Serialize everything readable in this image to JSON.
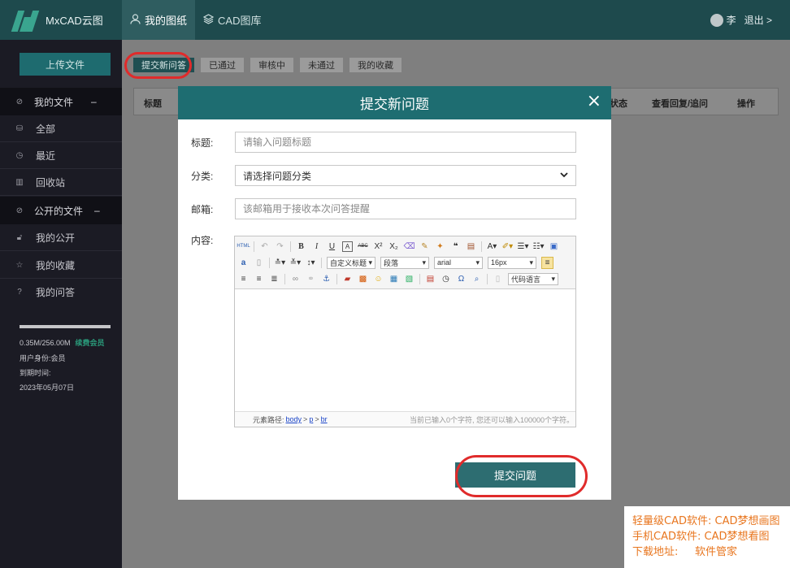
{
  "app": {
    "logo_text": "MxCAD云图"
  },
  "topnav": [
    {
      "label": "我的图纸",
      "icon": "user-icon",
      "active": true
    },
    {
      "label": "CAD图库",
      "icon": "layers-icon",
      "active": false
    }
  ],
  "user": {
    "name": "李",
    "logout": "退出 >"
  },
  "sidebar": {
    "upload": "上传文件",
    "my_files": {
      "label": "我的文件",
      "toggle": "–"
    },
    "my_file_items": [
      {
        "label": "全部",
        "icon": "database-icon"
      },
      {
        "label": "最近",
        "icon": "clock-icon"
      },
      {
        "label": "回收站",
        "icon": "trash-icon"
      }
    ],
    "public_files": {
      "label": "公开的文件",
      "toggle": "–"
    },
    "public_items": [
      {
        "label": "我的公开",
        "icon": "unlock-icon"
      },
      {
        "label": "我的收藏",
        "icon": "star-icon"
      },
      {
        "label": "我的问答",
        "icon": "question-icon"
      }
    ],
    "usage": "0.35M/256.00M",
    "renew": "续费会员",
    "identity": "用户身份:会员",
    "expire_label": "到期时间:",
    "expire_date": "2023年05月07日"
  },
  "tabs": [
    "提交新问答",
    "已通过",
    "审核中",
    "未通过",
    "我的收藏"
  ],
  "table_headers": {
    "title": "标题",
    "status": "状态",
    "reply": "查看回复/追问",
    "action": "操作"
  },
  "modal": {
    "title": "提交新问题",
    "close": "×",
    "title_label": "标题:",
    "title_placeholder": "请输入问题标题",
    "category_label": "分类:",
    "category_value": "请选择问题分类",
    "email_label": "邮箱:",
    "email_placeholder": "该邮箱用于接收本次问答提醒",
    "content_label": "内容:",
    "editor": {
      "combos": [
        "自定义标题",
        "段落",
        "arial",
        "16px"
      ],
      "code_lang": "代码语言",
      "path_label": "元素路径:",
      "path_body": "body",
      "path_p": "p",
      "path_br": "br",
      "char_count": "当前已输入0个字符, 您还可以输入100000个字符。"
    },
    "submit": "提交问题"
  },
  "ad": {
    "line1": "轻量级CAD软件: CAD梦想画图",
    "line2": "手机CAD软件:  CAD梦想看图",
    "line3": "下载地址:     软件管家"
  }
}
